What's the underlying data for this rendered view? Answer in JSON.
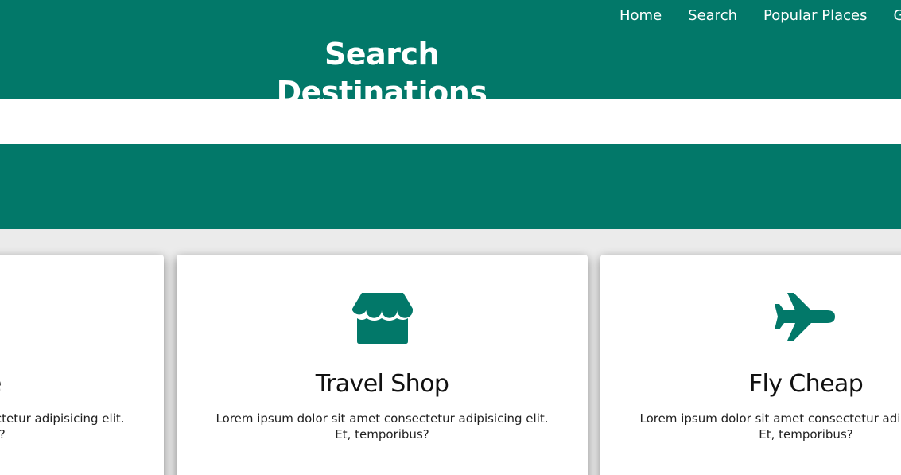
{
  "nav": {
    "items": [
      "Home",
      "Search",
      "Popular Places",
      "Gallery"
    ]
  },
  "header": {
    "title": "Search Destinations"
  },
  "cards": [
    {
      "title": "Explore",
      "icon": "explore-icon",
      "text": "Lorem ipsum dolor sit amet consectetur adipisicing elit. Et, temporibus?"
    },
    {
      "title": "Travel Shop",
      "icon": "storefront-icon",
      "text": "Lorem ipsum dolor sit amet consectetur adipisicing elit. Et, temporibus?"
    },
    {
      "title": "Fly Cheap",
      "icon": "airplane-icon",
      "text": "Lorem ipsum dolor sit amet consectetur adipisicing elit. Et, temporibus?"
    }
  ],
  "colors": {
    "primary": "#027869",
    "background": "#ebebeb",
    "card": "#ffffff",
    "text": "#111111"
  }
}
